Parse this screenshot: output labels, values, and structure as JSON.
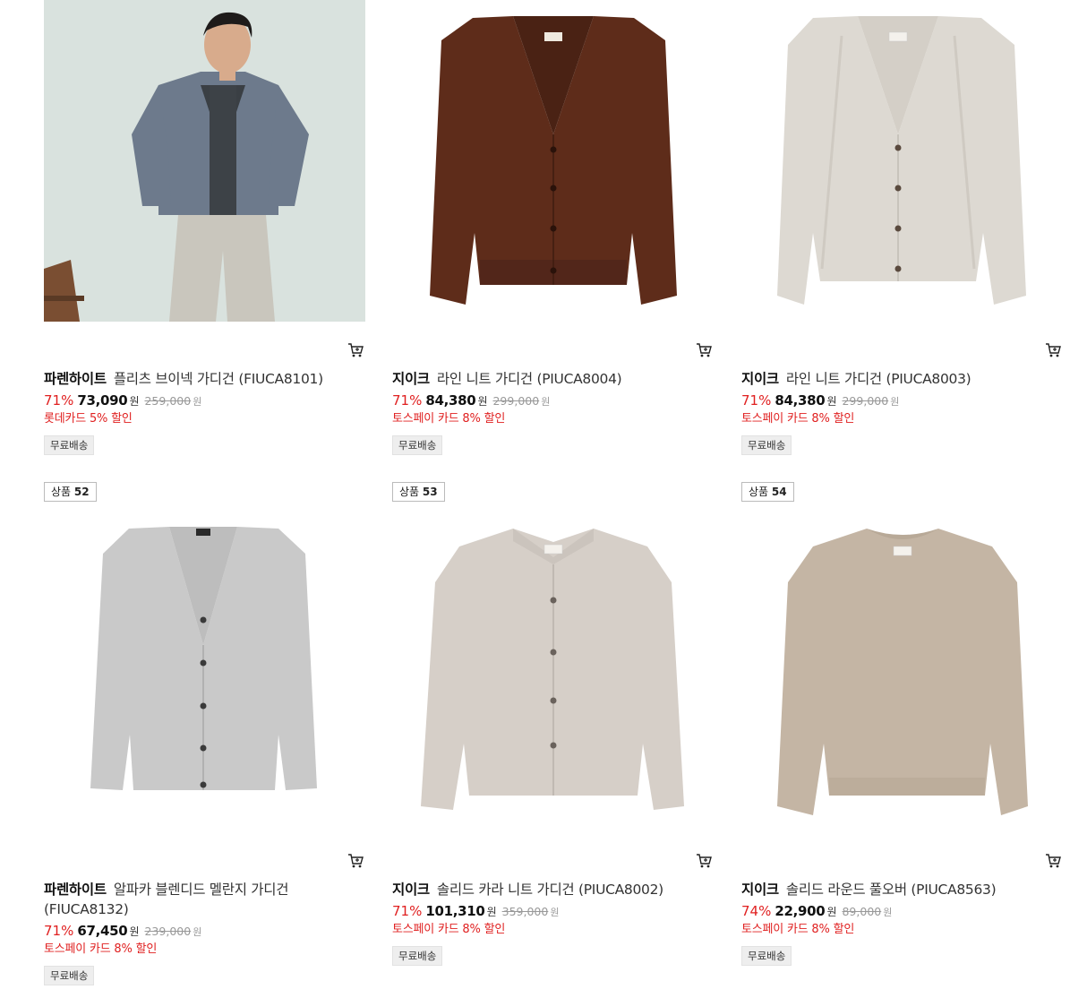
{
  "products": [
    {
      "brand": "파렌하이트",
      "name": "플리츠 브이넥 가디건 (FIUCA8101)",
      "discount": "71%",
      "price": "73,090",
      "currency": "원",
      "original_price": "259,000",
      "original_currency": "원",
      "promo": "롯데카드 5% 할인",
      "shipping": "무료배송",
      "image": "model-gray-cardigan",
      "color": "#6d7a8c"
    },
    {
      "brand": "지이크",
      "name": "라인 니트 가디건 (PIUCA8004)",
      "discount": "71%",
      "price": "84,380",
      "currency": "원",
      "original_price": "299,000",
      "original_currency": "원",
      "promo": "토스페이 카드 8% 할인",
      "shipping": "무료배송",
      "image": "brown-vneck-cardigan",
      "color": "#5a2a18"
    },
    {
      "brand": "지이크",
      "name": "라인 니트 가디건 (PIUCA8003)",
      "discount": "71%",
      "price": "84,380",
      "currency": "원",
      "original_price": "299,000",
      "original_currency": "원",
      "promo": "토스페이 카드 8% 할인",
      "shipping": "무료배송",
      "image": "ivory-vneck-cardigan",
      "color": "#ddd9d2"
    },
    {
      "rank_label": "상품",
      "rank_number": "52",
      "brand": "파렌하이트",
      "name": "알파카 블렌디드 멜란지 가디건 (FIUCA8132)",
      "discount": "71%",
      "price": "67,450",
      "currency": "원",
      "original_price": "239,000",
      "original_currency": "원",
      "promo": "토스페이 카드 8% 할인",
      "shipping": "무료배송",
      "image": "gray-melange-cardigan",
      "color": "#c9c9c9"
    },
    {
      "rank_label": "상품",
      "rank_number": "53",
      "brand": "지이크",
      "name": "솔리드 카라 니트 가디건 (PIUCA8002)",
      "discount": "71%",
      "price": "101,310",
      "currency": "원",
      "original_price": "359,000",
      "original_currency": "원",
      "promo": "토스페이 카드 8% 할인",
      "shipping": "무료배송",
      "image": "beige-collar-cardigan",
      "color": "#d6cfc8"
    },
    {
      "rank_label": "상품",
      "rank_number": "54",
      "brand": "지이크",
      "name": "솔리드 라운드 풀오버 (PIUCA8563)",
      "discount": "74%",
      "price": "22,900",
      "currency": "원",
      "original_price": "89,000",
      "original_currency": "원",
      "promo": "토스페이 카드 8% 할인",
      "shipping": "무료배송",
      "image": "beige-round-pullover",
      "color": "#c4b5a4"
    }
  ],
  "icons": {
    "cart": "cart-plus-icon"
  },
  "colors": {
    "discount": "#e02020",
    "promo": "#e02020"
  }
}
